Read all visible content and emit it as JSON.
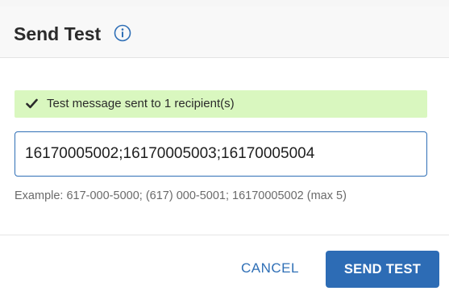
{
  "dialog": {
    "title": "Send Test",
    "info_icon": "info-circle-icon"
  },
  "alert": {
    "icon": "checkmark-icon",
    "text": "Test message sent to 1 recipient(s)",
    "background_color": "#d9f7bf"
  },
  "recipients": {
    "value": "16170005002;16170005003;16170005004",
    "hint": "Example: 617-000-5000; (617) 000-5001; 16170005002 (max 5)"
  },
  "actions": {
    "cancel_label": "CANCEL",
    "send_label": "SEND TEST"
  },
  "colors": {
    "accent": "#2d6cb5",
    "success_bg": "#d9f7bf",
    "header_bg": "#f8f8f8"
  }
}
